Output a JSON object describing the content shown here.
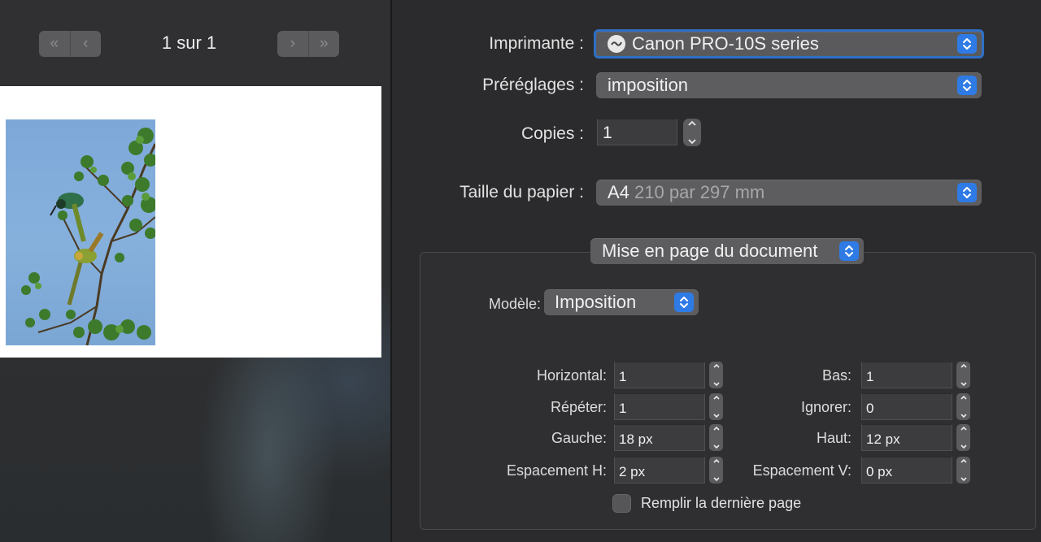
{
  "preview": {
    "page_counter": "1 sur 1",
    "first_page_icon": "double-chevron-left-icon",
    "prev_page_icon": "chevron-left-icon",
    "next_page_icon": "chevron-right-icon",
    "last_page_icon": "double-chevron-right-icon"
  },
  "settings": {
    "printer": {
      "label": "Imprimante :",
      "value": "Canon PRO-10S series",
      "icon": "printer-status-icon"
    },
    "presets": {
      "label": "Préréglages :",
      "value": "imposition"
    },
    "copies": {
      "label": "Copies :",
      "value": "1"
    },
    "paper_size": {
      "label": "Taille du papier :",
      "value": "A4",
      "detail": "210 par 297 mm"
    },
    "section": {
      "value": "Mise en page du document"
    },
    "layout": {
      "model": {
        "label": "Modèle:",
        "value": "Imposition"
      },
      "fields": [
        {
          "label": "Horizontal:",
          "value": "1"
        },
        {
          "label": "Bas:",
          "value": "1"
        },
        {
          "label": "Répéter:",
          "value": "1"
        },
        {
          "label": "Ignorer:",
          "value": "0"
        },
        {
          "label": "Gauche:",
          "value": "18 px"
        },
        {
          "label": "Haut:",
          "value": "12 px"
        },
        {
          "label": "Espacement H:",
          "value": "2 px"
        },
        {
          "label": "Espacement V:",
          "value": "0 px"
        }
      ],
      "fill_last_page": {
        "label": "Remplir la dernière page",
        "checked": false
      }
    }
  },
  "colors": {
    "accent": "#2f7be6",
    "focus_ring": "#2e6fc4",
    "window_bg": "#2b2b2d"
  }
}
